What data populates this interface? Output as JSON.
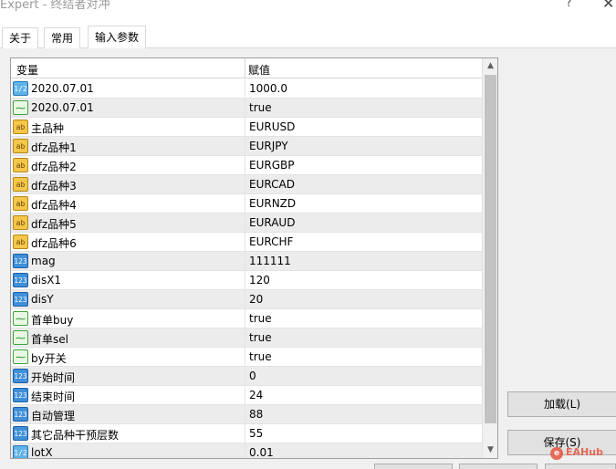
{
  "window": {
    "title": "Expert - 终结者对冲",
    "help_glyph": "?",
    "close_glyph": "✕"
  },
  "tabs": [
    {
      "label": "关于"
    },
    {
      "label": "常用"
    },
    {
      "label": "输入参数"
    }
  ],
  "grid": {
    "col_variable": "变量",
    "col_value": "赋值",
    "rows": [
      {
        "type": "double",
        "icon": "1/2",
        "name": "2020.07.01",
        "value": "1000.0"
      },
      {
        "type": "bool",
        "icon": "⁓",
        "name": "2020.07.01",
        "value": "true"
      },
      {
        "type": "string",
        "icon": "ab",
        "name": "主品种",
        "value": "EURUSD"
      },
      {
        "type": "string",
        "icon": "ab",
        "name": "dfz品种1",
        "value": "EURJPY"
      },
      {
        "type": "string",
        "icon": "ab",
        "name": "dfz品种2",
        "value": "EURGBP"
      },
      {
        "type": "string",
        "icon": "ab",
        "name": "dfz品种3",
        "value": "EURCAD"
      },
      {
        "type": "string",
        "icon": "ab",
        "name": "dfz品种4",
        "value": "EURNZD"
      },
      {
        "type": "string",
        "icon": "ab",
        "name": "dfz品种5",
        "value": "EURAUD"
      },
      {
        "type": "string",
        "icon": "ab",
        "name": "dfz品种6",
        "value": "EURCHF"
      },
      {
        "type": "int",
        "icon": "123",
        "name": "mag",
        "value": "111111"
      },
      {
        "type": "int",
        "icon": "123",
        "name": "disX1",
        "value": "120"
      },
      {
        "type": "int",
        "icon": "123",
        "name": "disY",
        "value": "20"
      },
      {
        "type": "bool",
        "icon": "⁓",
        "name": "首单buy",
        "value": "true"
      },
      {
        "type": "bool",
        "icon": "⁓",
        "name": "首单sel",
        "value": "true"
      },
      {
        "type": "bool",
        "icon": "⁓",
        "name": "by开关",
        "value": "true"
      },
      {
        "type": "int",
        "icon": "123",
        "name": "开始时间",
        "value": "0"
      },
      {
        "type": "int",
        "icon": "123",
        "name": "结束时间",
        "value": "24"
      },
      {
        "type": "int",
        "icon": "123",
        "name": "自动管理",
        "value": "88"
      },
      {
        "type": "int",
        "icon": "123",
        "name": "其它品种干预层数",
        "value": "55"
      },
      {
        "type": "double",
        "icon": "1/2",
        "name": "lotX",
        "value": "0.01"
      }
    ]
  },
  "scrollbar": {
    "up_glyph": "▲",
    "down_glyph": "▼"
  },
  "buttons": {
    "load": "加载(L)",
    "save": "保存(S)"
  },
  "watermark": {
    "text": "EAHub",
    "glyph": "e"
  }
}
